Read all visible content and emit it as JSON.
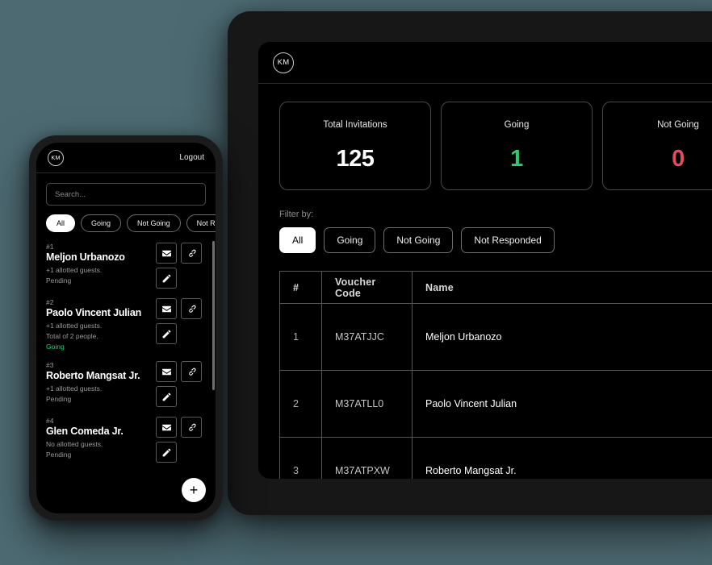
{
  "background_color": "#4d6a72",
  "desktop": {
    "avatar_initials": "KM",
    "stats": [
      {
        "label": "Total Invitations",
        "value": "125",
        "color": "#ffffff"
      },
      {
        "label": "Going",
        "value": "1",
        "color": "#2ecc71"
      },
      {
        "label": "Not Going",
        "value": "0",
        "color": "#e04c5f"
      }
    ],
    "filter_label": "Filter by:",
    "filters": [
      {
        "label": "All",
        "active": true
      },
      {
        "label": "Going",
        "active": false
      },
      {
        "label": "Not Going",
        "active": false
      },
      {
        "label": "Not Responded",
        "active": false
      }
    ],
    "table": {
      "columns": [
        "#",
        "Voucher Code",
        "Name"
      ],
      "rows": [
        {
          "num": "1",
          "code": "M37ATJJC",
          "name": "Meljon Urbanozo"
        },
        {
          "num": "2",
          "code": "M37ATLL0",
          "name": "Paolo Vincent Julian"
        },
        {
          "num": "3",
          "code": "M37ATPXW",
          "name": "Roberto Mangsat Jr."
        }
      ]
    }
  },
  "phone": {
    "avatar_initials": "KM",
    "logout_label": "Logout",
    "search_placeholder": "Search...",
    "filters": [
      {
        "label": "All",
        "active": true
      },
      {
        "label": "Going",
        "active": false
      },
      {
        "label": "Not Going",
        "active": false
      },
      {
        "label": "Not Responded",
        "active": false
      }
    ],
    "items": [
      {
        "index": "#1",
        "name": "Meljon Urbanozo",
        "guests": "+1 allotted guests.",
        "total": "",
        "status": "Pending",
        "status_going": false
      },
      {
        "index": "#2",
        "name": "Paolo Vincent Julian",
        "guests": "+1 allotted guests.",
        "total": "Total of 2 people.",
        "status": "Going",
        "status_going": true
      },
      {
        "index": "#3",
        "name": "Roberto Mangsat Jr.",
        "guests": "+1 allotted guests.",
        "total": "",
        "status": "Pending",
        "status_going": false
      },
      {
        "index": "#4",
        "name": "Glen Comeda Jr.",
        "guests": "No allotted guests.",
        "total": "",
        "status": "Pending",
        "status_going": false
      }
    ],
    "fab_label": "+"
  }
}
